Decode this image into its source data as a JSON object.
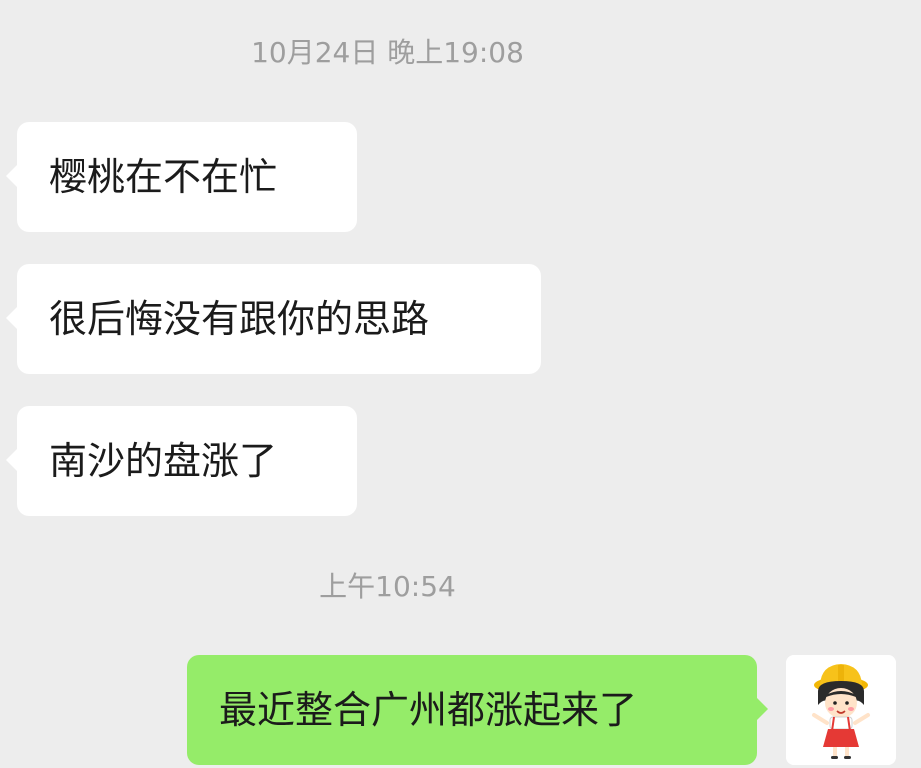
{
  "chat": {
    "timestamps": [
      "10月24日 晚上19:08",
      "上午10:54"
    ],
    "messages": [
      {
        "side": "incoming",
        "text": "樱桃在不在忙"
      },
      {
        "side": "incoming",
        "text": "很后悔没有跟你的思路"
      },
      {
        "side": "incoming",
        "text": "南沙的盘涨了"
      },
      {
        "side": "outgoing",
        "text": "最近整合广州都涨起来了"
      }
    ],
    "avatar_icon": "cartoon-girl-avatar-icon"
  },
  "colors": {
    "background": "#ededed",
    "incoming_bubble": "#ffffff",
    "outgoing_bubble": "#95ec69",
    "timestamp_text": "#9e9e9e",
    "message_text": "#1b1b1b"
  }
}
